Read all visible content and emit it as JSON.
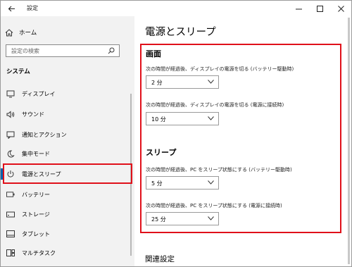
{
  "window": {
    "title": "設定",
    "back_icon": "back-arrow-icon",
    "controls": [
      "minimize-icon",
      "maximize-icon",
      "close-icon"
    ]
  },
  "sidebar": {
    "home_label": "ホーム",
    "search_placeholder": "設定の検索",
    "section_label": "システム",
    "items": [
      {
        "label": "ディスプレイ",
        "icon": "display-icon",
        "active": false
      },
      {
        "label": "サウンド",
        "icon": "sound-icon",
        "active": false
      },
      {
        "label": "通知とアクション",
        "icon": "notification-icon",
        "active": false
      },
      {
        "label": "集中モード",
        "icon": "moon-icon",
        "active": false
      },
      {
        "label": "電源とスリープ",
        "icon": "power-icon",
        "active": true
      },
      {
        "label": "バッテリー",
        "icon": "battery-icon",
        "active": false
      },
      {
        "label": "ストレージ",
        "icon": "storage-icon",
        "active": false
      },
      {
        "label": "タブレット",
        "icon": "tablet-icon",
        "active": false
      },
      {
        "label": "マルチタスク",
        "icon": "multitask-icon",
        "active": false
      }
    ]
  },
  "main": {
    "title": "電源とスリープ",
    "screen": {
      "heading": "画面",
      "battery_desc": "次の時間が経過後、ディスプレイの電源を切る (バッテリー駆動時)",
      "battery_value": "2 分",
      "plugged_desc": "次の時間が経過後、ディスプレイの電源を切る (電源に接続時)",
      "plugged_value": "10 分"
    },
    "sleep": {
      "heading": "スリープ",
      "battery_desc": "次の時間が経過後、PC をスリープ状態にする (バッテリー駆動時)",
      "battery_value": "5 分",
      "plugged_desc": "次の時間が経過後、PC をスリープ状態にする (電源に接続時)",
      "plugged_value": "25 分"
    },
    "related_heading": "関連設定"
  },
  "colors": {
    "highlight": "#e0101a",
    "accent": "#0063b1",
    "sidebar_bg": "#f2f2f2"
  }
}
